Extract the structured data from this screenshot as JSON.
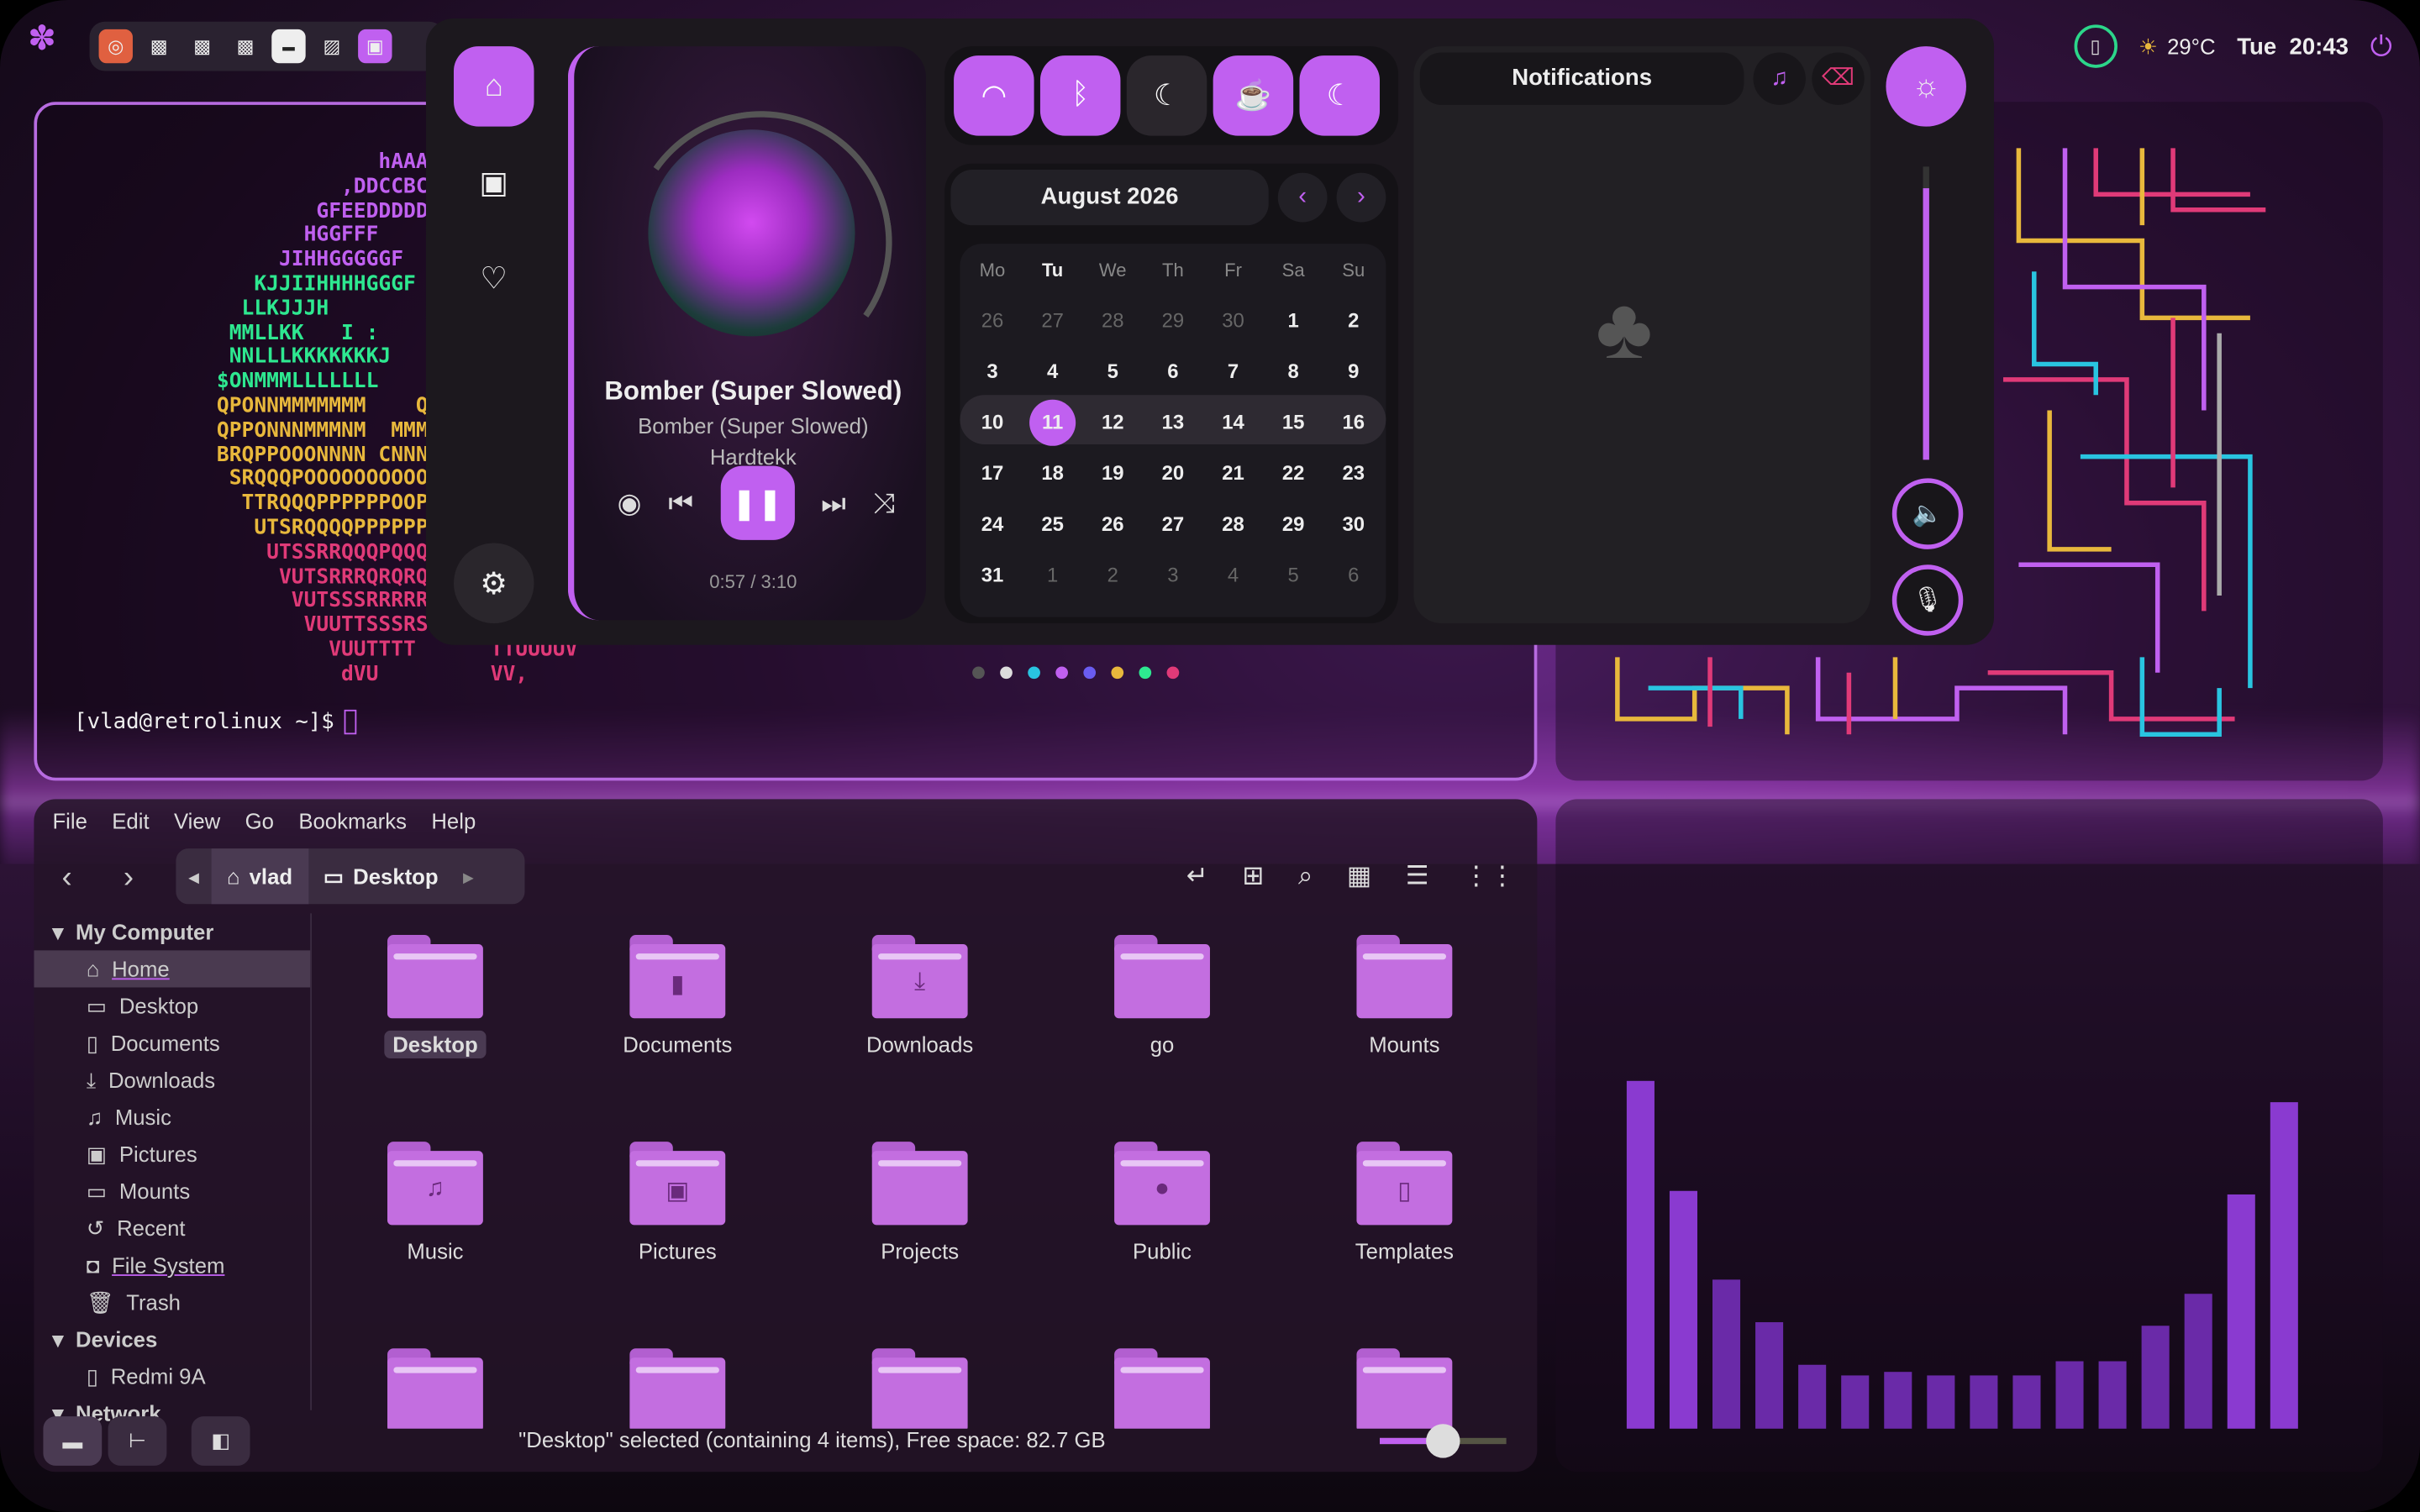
{
  "topbar": {
    "weather_temp": "29°C",
    "clock_day": "Tue",
    "clock_time": "20:43",
    "accent": "#c060f0"
  },
  "terminal": {
    "ascii_lines": [
      {
        "text": "                    hAAAAA",
        "color": "#c060f0"
      },
      {
        "text": "                 ,DDCCBCBACB",
        "color": "#c060f0"
      },
      {
        "text": "               GFEEDDDDDDDDD",
        "color": "#c060f0"
      },
      {
        "text": "              HGGFFF        EEF",
        "color": "#c060f0"
      },
      {
        "text": "            JIHHGGGGGF       GF",
        "color": "#c060f0"
      },
      {
        "text": "          KJJIIHHHHGGGF",
        "color": "#2ee890"
      },
      {
        "text": "         LLKJJJH",
        "color": "#2ee890"
      },
      {
        "text": "        MMLLKK   I :",
        "color": "#2ee890"
      },
      {
        "text": "        NNLLLKKKKKKKJ",
        "color": "#2ee890"
      },
      {
        "text": "       $ONMMMLLLLLLL      LK",
        "color": "#2ee890"
      },
      {
        "text": "       QPONNMMMMMMM    QMMM",
        "color": "#e8b83c"
      },
      {
        "text": "       QPPONNNMMMNM  MMMNM",
        "color": "#e8b83c"
      },
      {
        "text": "       BRQPPOOONNNN CNNNNM",
        "color": "#e8b83c"
      },
      {
        "text": "        SRQQQPOOOOOOOOOOON",
        "color": "#e8b83c"
      },
      {
        "text": "         TTRQQQPPPPPPOOPPP",
        "color": "#e8b83c"
      },
      {
        "text": "          UTSRQQQQPPPPPPPP",
        "color": "#e8b83c"
      },
      {
        "text": "           UTSSRRQQQPQQQQQ",
        "color": "#e03a78"
      },
      {
        "text": "            VUTSRRRQRQRQQQ",
        "color": "#e03a78"
      },
      {
        "text": "             VUTSSSRRRRRQ",
        "color": "#e03a78"
      },
      {
        "text": "              VUUTTSSSRS",
        "color": "#e03a78"
      },
      {
        "text": "                VUUTTTT      TTUUUUV",
        "color": "#e03a78"
      },
      {
        "text": "                 dVU         VV,",
        "color": "#e03a78"
      }
    ],
    "prompt": "[vlad@retrolinux ~]$"
  },
  "panel": {
    "player": {
      "title": "Bomber (Super Slowed)",
      "album": "Bomber (Super Slowed)",
      "artist": "Hardtekk",
      "time": "0:57 / 3:10",
      "progress": 0.3
    },
    "calendar": {
      "month": "August 2026",
      "weekdays": [
        "Mo",
        "Tu",
        "We",
        "Th",
        "Fr",
        "Sa",
        "Su"
      ],
      "weeks": [
        [
          "26",
          "27",
          "28",
          "29",
          "30",
          "1",
          "2"
        ],
        [
          "3",
          "4",
          "5",
          "6",
          "7",
          "8",
          "9"
        ],
        [
          "10",
          "11",
          "12",
          "13",
          "14",
          "15",
          "16"
        ],
        [
          "17",
          "18",
          "19",
          "20",
          "21",
          "22",
          "23"
        ],
        [
          "24",
          "25",
          "26",
          "27",
          "28",
          "29",
          "30"
        ],
        [
          "31",
          "1",
          "2",
          "3",
          "4",
          "5",
          "6"
        ]
      ],
      "today": "11"
    },
    "notifications": {
      "title": "Notifications"
    },
    "page_dots": [
      "#555555",
      "#dddddd",
      "#29c4e0",
      "#c060f0",
      "#6a5cf0",
      "#e8b83c",
      "#2ee890",
      "#e03a78"
    ]
  },
  "filemanager": {
    "menu": [
      "File",
      "Edit",
      "View",
      "Go",
      "Bookmarks",
      "Help"
    ],
    "breadcrumb": [
      "vlad",
      "Desktop"
    ],
    "sidebar": {
      "sections": [
        {
          "title": "My Computer",
          "items": [
            {
              "label": "Home",
              "icon": "home-icon"
            },
            {
              "label": "Desktop",
              "icon": "folder-icon"
            },
            {
              "label": "Documents",
              "icon": "document-icon"
            },
            {
              "label": "Downloads",
              "icon": "download-icon"
            },
            {
              "label": "Music",
              "icon": "music-icon"
            },
            {
              "label": "Pictures",
              "icon": "picture-icon"
            },
            {
              "label": "Mounts",
              "icon": "folder-icon"
            },
            {
              "label": "Recent",
              "icon": "recent-icon"
            },
            {
              "label": "File System",
              "icon": "drive-icon"
            },
            {
              "label": "Trash",
              "icon": "trash-icon"
            }
          ]
        },
        {
          "title": "Devices",
          "items": [
            {
              "label": "Redmi 9A",
              "icon": "phone-icon"
            }
          ]
        },
        {
          "title": "Network",
          "items": []
        }
      ]
    },
    "items": [
      {
        "label": "Desktop",
        "glyph": ""
      },
      {
        "label": "Documents",
        "glyph": "▮"
      },
      {
        "label": "Downloads",
        "glyph": "⤓"
      },
      {
        "label": "go",
        "glyph": ""
      },
      {
        "label": "Mounts",
        "glyph": ""
      },
      {
        "label": "Music",
        "glyph": "♫"
      },
      {
        "label": "Pictures",
        "glyph": "▣"
      },
      {
        "label": "Projects",
        "glyph": ""
      },
      {
        "label": "Public",
        "glyph": "●"
      },
      {
        "label": "Templates",
        "glyph": "▯"
      },
      {
        "label": "",
        "glyph": ""
      },
      {
        "label": "",
        "glyph": ""
      },
      {
        "label": "",
        "glyph": ""
      },
      {
        "label": "",
        "glyph": ""
      },
      {
        "label": "",
        "glyph": ""
      }
    ],
    "status": "\"Desktop\" selected (containing 4 items), Free space: 82.7 GB",
    "zoom_level": 0.5
  },
  "visualizer": {
    "levels": [
      0.98,
      0.67,
      0.42,
      0.3,
      0.18,
      0.15,
      0.16,
      0.15,
      0.15,
      0.15,
      0.19,
      0.19,
      0.29,
      0.38,
      0.66,
      0.92
    ]
  }
}
